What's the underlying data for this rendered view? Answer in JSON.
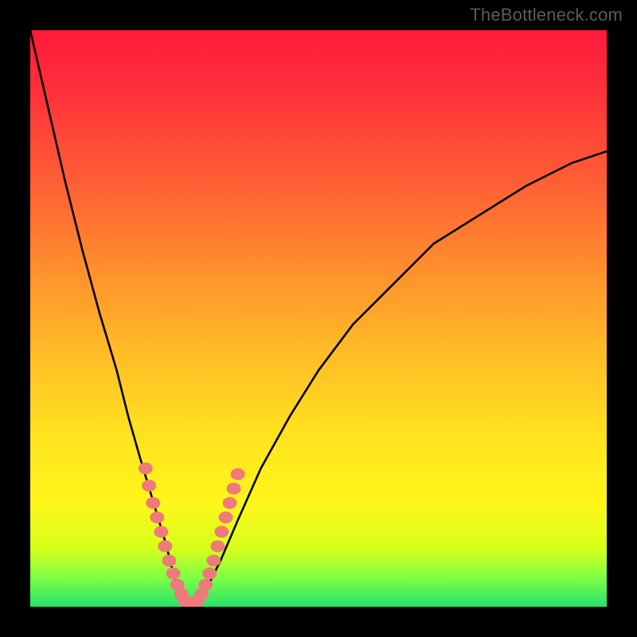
{
  "watermark": "TheBottleneck.com",
  "colors": {
    "curve": "#000000",
    "markers_fill": "#f07a7a",
    "markers_stroke": "#9a3a3a",
    "frame_bg": "#000000"
  },
  "chart_data": {
    "type": "line",
    "title": "",
    "xlabel": "",
    "ylabel": "",
    "xlim": [
      0,
      100
    ],
    "ylim": [
      0,
      100
    ],
    "grid": false,
    "legend": false,
    "series": [
      {
        "name": "bottleneck-curve",
        "x": [
          0,
          3,
          6,
          9,
          12,
          15,
          17,
          19,
          20.5,
          22,
          23.5,
          24.5,
          25.5,
          27,
          28.5,
          30.5,
          33,
          36,
          40,
          45,
          50,
          56,
          62,
          70,
          78,
          86,
          94,
          100
        ],
        "y": [
          100,
          87,
          74,
          62,
          51,
          41,
          33,
          26,
          21,
          16,
          11,
          7,
          3,
          0.5,
          0.5,
          3,
          8,
          15,
          24,
          33,
          41,
          49,
          55,
          63,
          68,
          73,
          77,
          79
        ]
      }
    ],
    "markers": {
      "name": "highlighted-points",
      "points": [
        {
          "x": 20.0,
          "y": 24.0
        },
        {
          "x": 20.6,
          "y": 21.0
        },
        {
          "x": 21.3,
          "y": 18.0
        },
        {
          "x": 22.0,
          "y": 15.5
        },
        {
          "x": 22.7,
          "y": 13.0
        },
        {
          "x": 23.4,
          "y": 10.5
        },
        {
          "x": 24.1,
          "y": 8.0
        },
        {
          "x": 24.8,
          "y": 5.8
        },
        {
          "x": 25.5,
          "y": 3.8
        },
        {
          "x": 26.2,
          "y": 2.2
        },
        {
          "x": 26.9,
          "y": 1.0
        },
        {
          "x": 27.6,
          "y": 0.4
        },
        {
          "x": 28.3,
          "y": 0.4
        },
        {
          "x": 29.0,
          "y": 1.0
        },
        {
          "x": 29.7,
          "y": 2.2
        },
        {
          "x": 30.4,
          "y": 3.8
        },
        {
          "x": 31.1,
          "y": 5.8
        },
        {
          "x": 31.8,
          "y": 8.0
        },
        {
          "x": 32.5,
          "y": 10.5
        },
        {
          "x": 33.2,
          "y": 13.0
        },
        {
          "x": 33.9,
          "y": 15.5
        },
        {
          "x": 34.6,
          "y": 18.0
        },
        {
          "x": 35.3,
          "y": 20.5
        },
        {
          "x": 36.0,
          "y": 23.0
        }
      ]
    },
    "gradient_stops": [
      {
        "pos": 0.0,
        "color": "#ff1a3b"
      },
      {
        "pos": 0.25,
        "color": "#ff5a35"
      },
      {
        "pos": 0.55,
        "color": "#ffb927"
      },
      {
        "pos": 0.82,
        "color": "#fff61a"
      },
      {
        "pos": 1.0,
        "color": "#26e26b"
      }
    ]
  }
}
